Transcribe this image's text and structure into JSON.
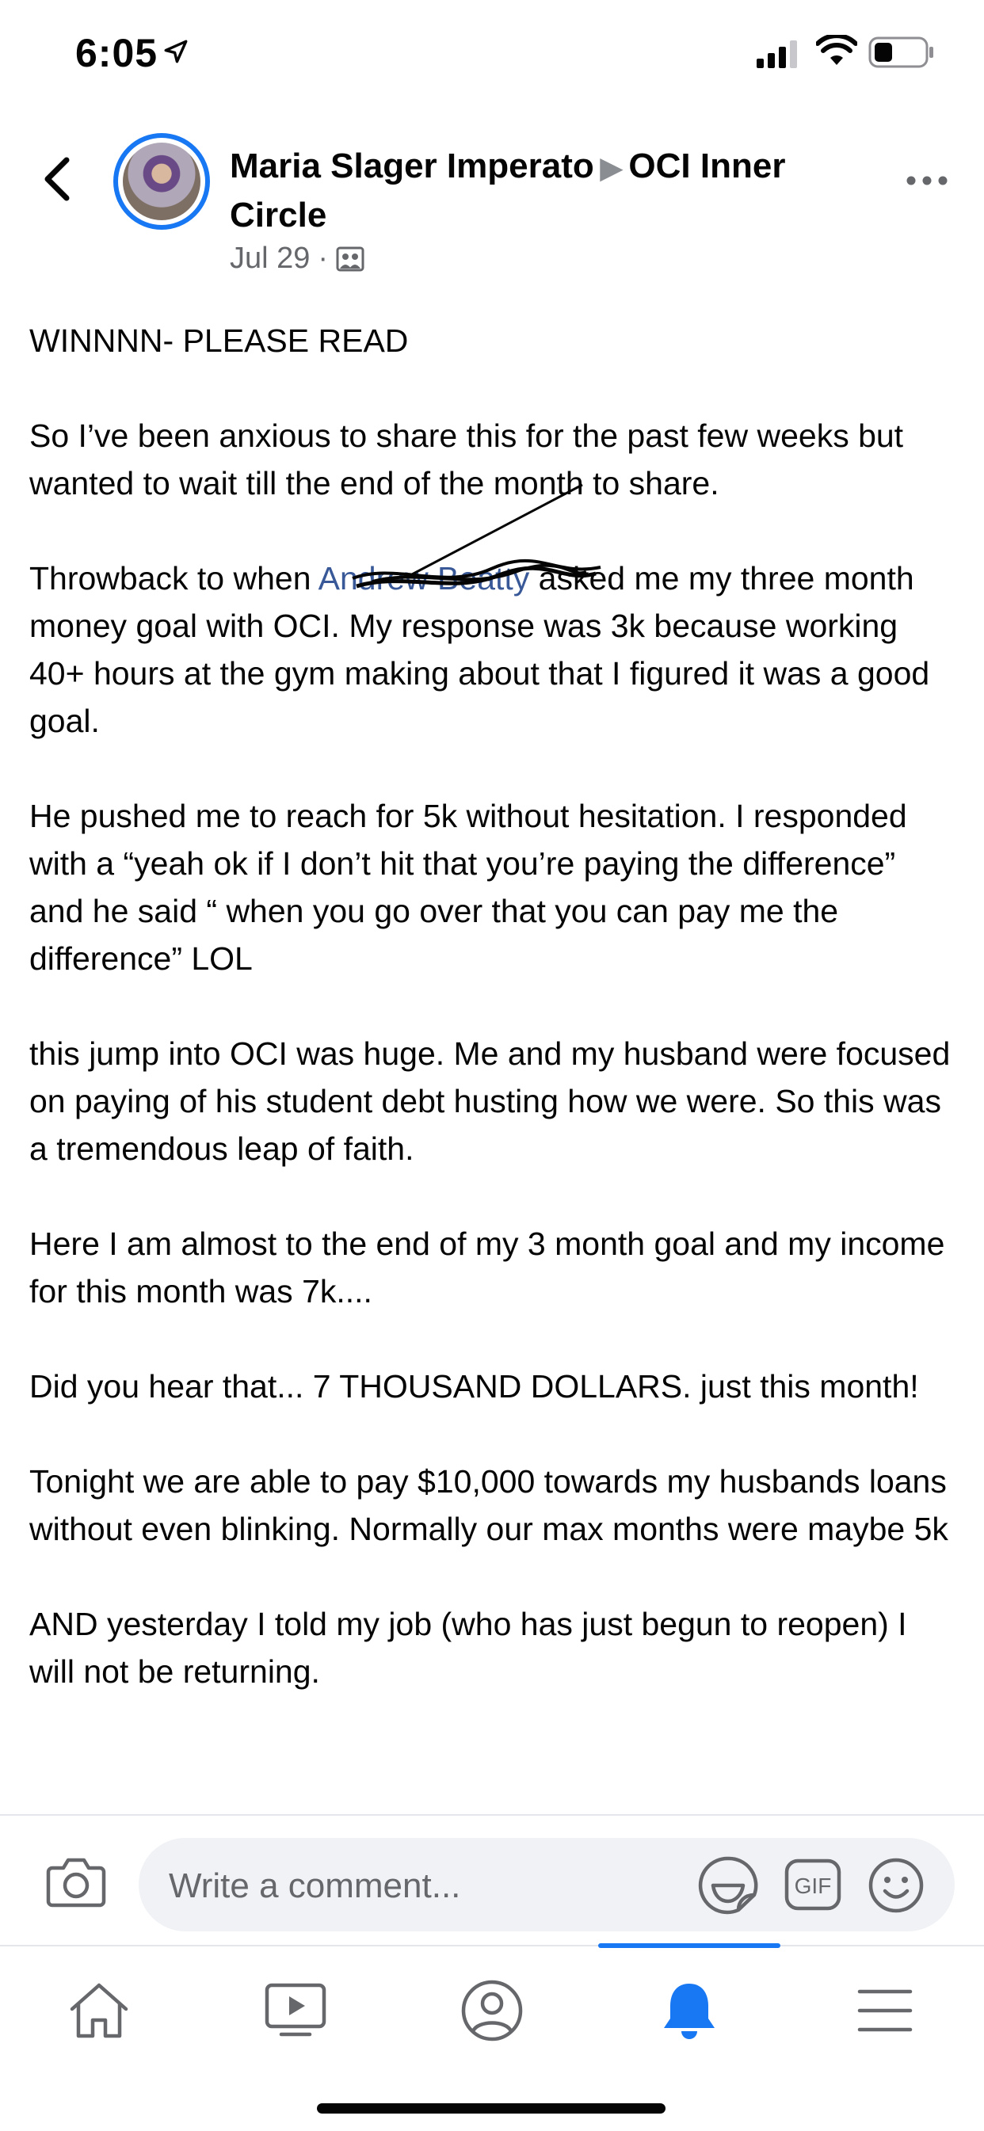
{
  "status_bar": {
    "time": "6:05"
  },
  "post": {
    "author": "Maria Slager Imperato",
    "group": "OCI Inner Circle",
    "date": "Jul 29",
    "meta_separator": "·",
    "paragraphs": [
      "WINNNN- PLEASE READ",
      "So I’ve been anxious to share this for the past few weeks but wanted to wait till the end of the month to share.",
      "He pushed me to reach for 5k without hesitation. I responded with a “yeah ok if I don’t hit that you’re paying the difference” and he said “ when you go over that you can pay me the difference” LOL",
      "this jump into OCI was huge. Me and my husband were focused on paying of his student debt husting how we were. So this was a tremendous leap of faith.",
      "Here I am almost to the end of my 3 month goal and my income for this month was 7k....",
      "Did you hear that... 7 THOUSAND DOLLARS. just this month!",
      "Tonight we are able to pay $10,000 towards my husbands loans without even blinking. Normally our max months were maybe 5k",
      "AND yesterday I told my job (who has just begun to reopen) I will not be returning."
    ],
    "throwback": {
      "before": "Throwback to when ",
      "mention": "Andrew Beatty",
      "after": " asked me my three month money goal with OCI. My response was 3k because working 40+ hours at the gym making about that I figured it was a good goal."
    }
  },
  "comment_bar": {
    "placeholder": "Write a comment...",
    "gif_label": "GIF"
  },
  "nav": {
    "active": "notifications",
    "accent": "#1877f2"
  },
  "colors": {
    "accent": "#1877f2",
    "text": "#050505",
    "secondary": "#65676b",
    "input_bg": "#f0f2f5"
  }
}
